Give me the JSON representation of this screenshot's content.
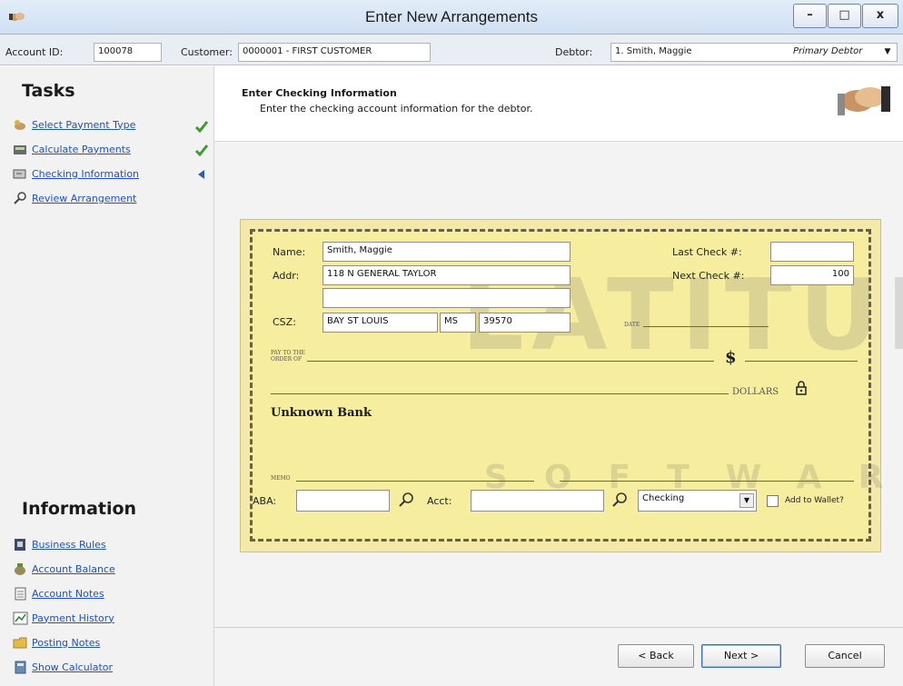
{
  "window": {
    "title": "Enter New Arrangements",
    "minimize_label": "–",
    "maximize_label": "□",
    "close_label": "x"
  },
  "account_bar": {
    "account_id_label": "Account ID:",
    "account_id_value": "100078",
    "customer_label": "Customer:",
    "customer_value": "0000001 - FIRST CUSTOMER",
    "debtor_label": "Debtor:",
    "debtor_value": "1. Smith, Maggie",
    "debtor_type": "Primary Debtor"
  },
  "sidebar": {
    "tasks_title": "Tasks",
    "tasks": [
      {
        "label": "Select Payment Type",
        "status": "done"
      },
      {
        "label": "Calculate Payments",
        "status": "done"
      },
      {
        "label": "Checking Information",
        "status": "current"
      },
      {
        "label": "Review Arrangement",
        "status": "pending"
      }
    ],
    "info_title": "Information",
    "info_links": [
      {
        "label": "Business Rules"
      },
      {
        "label": "Account Balance"
      },
      {
        "label": "Account Notes"
      },
      {
        "label": "Payment History"
      },
      {
        "label": "Posting Notes"
      },
      {
        "label": "Show Calculator"
      }
    ]
  },
  "header": {
    "title": "Enter Checking Information",
    "subtitle": "Enter the checking account information for the debtor."
  },
  "check": {
    "name_label": "Name:",
    "name_value": "Smith, Maggie",
    "addr_label": "Addr:",
    "addr1_value": "118 N GENERAL TAYLOR",
    "addr2_value": "",
    "csz_label": "CSZ:",
    "city_value": "BAY ST LOUIS",
    "state_value": "MS",
    "zip_value": "39570",
    "last_check_label": "Last Check #:",
    "last_check_value": "",
    "next_check_label": "Next Check #:",
    "next_check_value": "100",
    "date_label": "DATE",
    "pay_to_line1": "PAY TO THE",
    "pay_to_line2": "ORDER OF",
    "dollar_sign": "$",
    "dollars_label": "DOLLARS",
    "bank_name": "Unknown Bank",
    "memo_label": "MEMO",
    "aba_label": "ABA:",
    "aba_value": "",
    "acct_label": "Acct:",
    "acct_value": "",
    "account_type_value": "Checking",
    "add_to_wallet_label": "Add to Wallet?",
    "add_to_wallet_checked": false,
    "watermark_main": "LATITUDE",
    "watermark_sub": "SOFTWARE"
  },
  "buttons": {
    "back": "< Back",
    "next": "Next >",
    "cancel": "Cancel"
  },
  "colors": {
    "link": "#1f4fd1",
    "check_bg": "#f7ed9e",
    "check_mark": "#3f9a2f",
    "current_arrow": "#2f5fb5"
  }
}
